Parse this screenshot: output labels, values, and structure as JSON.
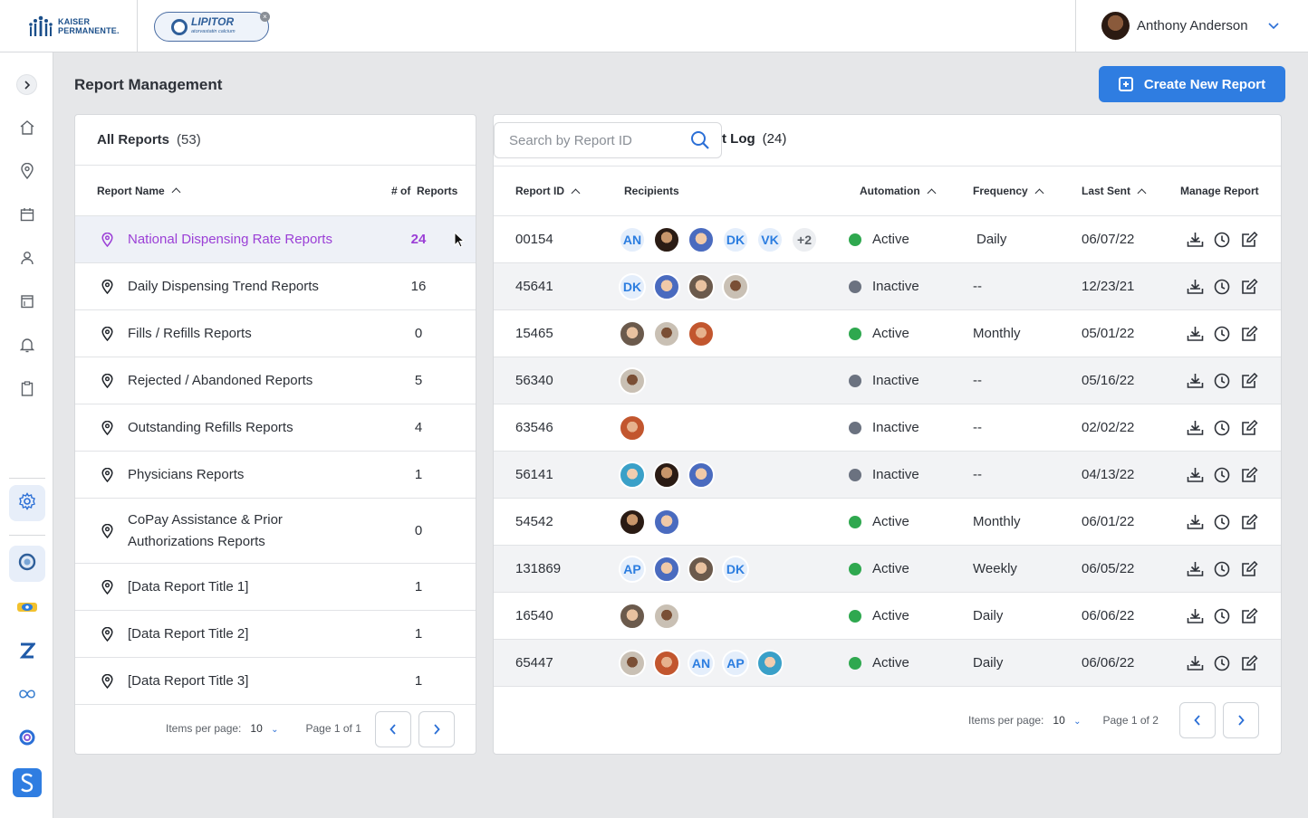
{
  "header": {
    "brand_line1": "KAISER",
    "brand_line2": "PERMANENTE.",
    "product_pill": "LIPITOR",
    "product_pill_sub": "atorvastatin calcium",
    "user_name": "Anthony Anderson"
  },
  "page": {
    "title": "Report Management",
    "create_button": "Create New Report"
  },
  "left_panel": {
    "title": "All Reports",
    "count": "(53)",
    "col_name": "Report Name",
    "col_count": "# of  Reports",
    "rows": [
      {
        "name": "National Dispensing Rate Reports",
        "count": "24",
        "selected": true
      },
      {
        "name": "Daily Dispensing Trend Reports",
        "count": "16"
      },
      {
        "name": "Fills / Refills Reports",
        "count": "0"
      },
      {
        "name": "Rejected / Abandoned Reports",
        "count": "5"
      },
      {
        "name": "Outstanding Refills Reports",
        "count": "4"
      },
      {
        "name": "Physicians Reports",
        "count": "1"
      },
      {
        "name": "CoPay Assistance & Prior Authorizations Reports",
        "count": "0"
      },
      {
        "name": "[Data Report Title 1]",
        "count": "1"
      },
      {
        "name": "[Data Report Title 2]",
        "count": "1"
      },
      {
        "name": "[Data Report Title 3]",
        "count": "1"
      }
    ],
    "pager": {
      "items_label": "Items per page:",
      "items_value": "10",
      "page_label": "Page 1 of 1"
    }
  },
  "right_panel": {
    "search_placeholder": "Search by Report ID",
    "title_partial": "t Log",
    "count": "(24)",
    "columns": {
      "id": "Report ID",
      "recipients": "Recipients",
      "automation": "Automation",
      "frequency": "Frequency",
      "last_sent": "Last Sent",
      "manage": "Manage Report"
    },
    "rows": [
      {
        "id": "00154",
        "recipients": [
          "AN",
          "photo",
          "photo",
          "DK",
          "VK",
          "+2"
        ],
        "automation": "Active",
        "frequency": "Daily",
        "last_sent": "06/07/22"
      },
      {
        "id": "45641",
        "recipients": [
          "DK",
          "photo",
          "photo",
          "photo"
        ],
        "automation": "Inactive",
        "frequency": "--",
        "last_sent": "12/23/21"
      },
      {
        "id": "15465",
        "recipients": [
          "photo",
          "photo",
          "photo"
        ],
        "automation": "Active",
        "frequency": "Monthly",
        "last_sent": "05/01/22"
      },
      {
        "id": "56340",
        "recipients": [
          "photo"
        ],
        "automation": "Inactive",
        "frequency": "--",
        "last_sent": "05/16/22"
      },
      {
        "id": "63546",
        "recipients": [
          "photo"
        ],
        "automation": "Inactive",
        "frequency": "--",
        "last_sent": "02/02/22"
      },
      {
        "id": "56141",
        "recipients": [
          "photo",
          "photo",
          "photo"
        ],
        "automation": "Inactive",
        "frequency": "--",
        "last_sent": "04/13/22"
      },
      {
        "id": "54542",
        "recipients": [
          "photo",
          "photo"
        ],
        "automation": "Active",
        "frequency": "Monthly",
        "last_sent": "06/01/22"
      },
      {
        "id": "131869",
        "recipients": [
          "AP",
          "photo",
          "photo",
          "DK"
        ],
        "automation": "Active",
        "frequency": "Weekly",
        "last_sent": "06/05/22"
      },
      {
        "id": "16540",
        "recipients": [
          "photo",
          "photo"
        ],
        "automation": "Active",
        "frequency": "Daily",
        "last_sent": "06/06/22"
      },
      {
        "id": "65447",
        "recipients": [
          "photo",
          "photo",
          "AN",
          "AP",
          "photo"
        ],
        "automation": "Active",
        "frequency": "Daily",
        "last_sent": "06/06/22"
      }
    ],
    "pager": {
      "items_label": "Items per page:",
      "items_value": "10",
      "page_label": "Page 1 of 2"
    }
  },
  "colors": {
    "accent": "#2f7de1",
    "selected": "#9b3fd6",
    "active": "#2fa84f",
    "inactive": "#6b7280"
  },
  "sidebar_icons": [
    "chevron-right-icon",
    "home-icon",
    "location-pin-icon",
    "calendar-icon",
    "user-icon",
    "archive-icon",
    "bell-icon",
    "clipboard-icon",
    "gear-icon"
  ]
}
